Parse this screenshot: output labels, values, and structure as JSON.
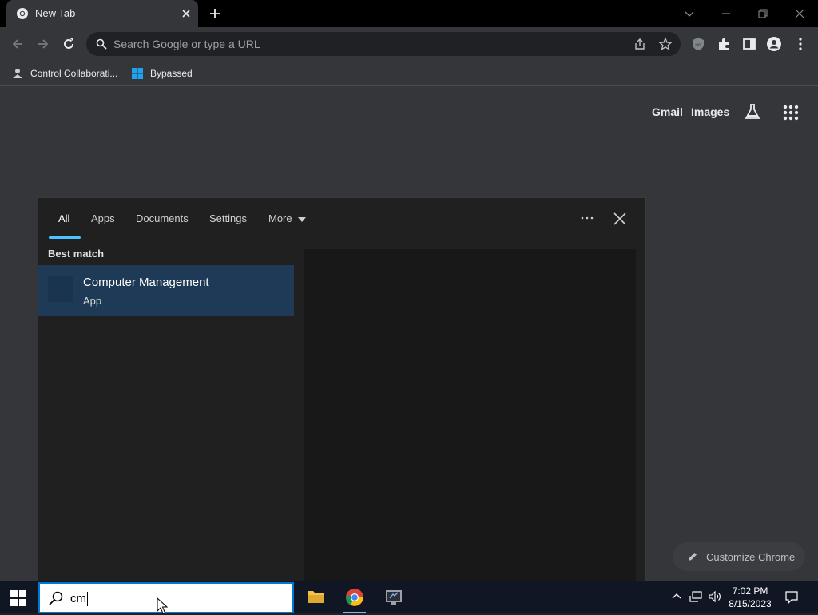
{
  "browser": {
    "tab_title": "New Tab",
    "omnibox_placeholder": "Search Google or type a URL",
    "bookmarks": [
      {
        "label": "Control Collaborati..."
      },
      {
        "label": "Bypassed"
      }
    ]
  },
  "newtab": {
    "gmail": "Gmail",
    "images": "Images",
    "customize": "Customize Chrome"
  },
  "start_search": {
    "tabs": [
      "All",
      "Apps",
      "Documents",
      "Settings",
      "More"
    ],
    "best_match_label": "Best match",
    "result": {
      "name": "Computer Management",
      "type": "App"
    }
  },
  "taskbar": {
    "search_value": "cm",
    "time": "7:02 PM",
    "date": "8/15/2023"
  },
  "colors": {
    "accent": "#4cc2ff",
    "selected_result": "#1e3a56",
    "taskbar": "#101623"
  }
}
